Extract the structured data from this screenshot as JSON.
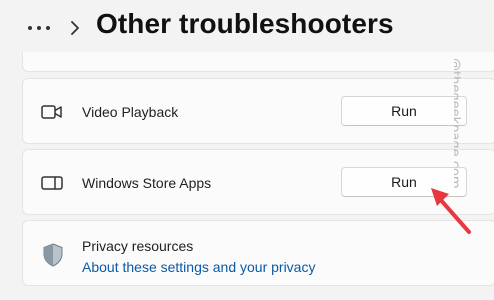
{
  "header": {
    "more_icon": "more-dots-icon",
    "chevron_icon": "chevron-right-icon",
    "title": "Other troubleshooters"
  },
  "rows": [
    {
      "icon": "video-camera-icon",
      "label": "Video Playback",
      "button_label": "Run"
    },
    {
      "icon": "store-apps-icon",
      "label": "Windows Store Apps",
      "button_label": "Run"
    }
  ],
  "privacy": {
    "icon": "shield-icon",
    "title": "Privacy resources",
    "link": "About these settings and your privacy"
  },
  "watermark": "@thegeekpage.com",
  "colors": {
    "background": "#f3f3f3",
    "card": "#fbfbfb",
    "link": "#0a5aa8",
    "arrow": "#e8383d"
  }
}
